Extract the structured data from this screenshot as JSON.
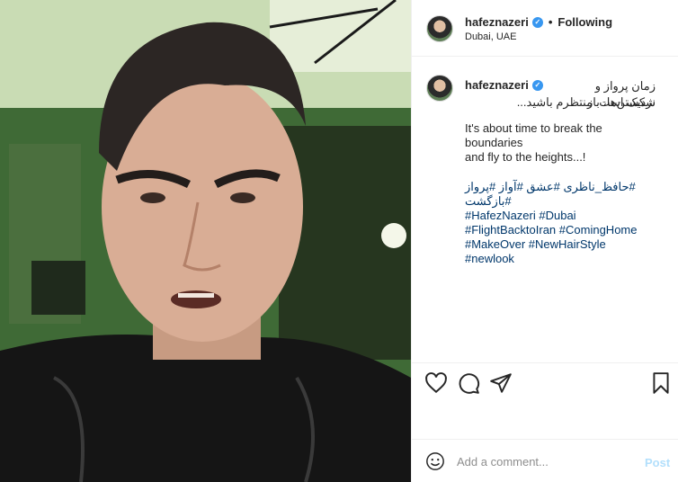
{
  "post": {
    "username": "hafeznazeri",
    "follow_label": "Following",
    "location": "Dubai, UAE",
    "caption_rtl": [
      "زمان پرواز و شکستن‌ها، باز",
      "نزدیک است. منتظرم باشید..."
    ],
    "caption_en": [
      "It's about time to break the",
      "boundaries",
      "and fly to the heights...!"
    ],
    "hashtags_rtl": "#حافظ_ناظری #عشق #آواز #پرواز #بازگشت",
    "hashtags_lines": [
      "#HafezNazeri #Dubai",
      "#FlightBacktoIran #ComingHome",
      "#MakeOver #NewHairStyle",
      "#newlook"
    ]
  },
  "comment": {
    "placeholder": "Add a comment...",
    "post_label": "Post"
  },
  "icons": [
    "verified-badge-icon",
    "heart-icon",
    "comment-icon",
    "share-icon",
    "bookmark-icon",
    "emoji-icon"
  ],
  "colors": {
    "link": "#00376b",
    "verified": "#3897f0",
    "post_disabled": "#b2dffc",
    "border": "#efefef"
  }
}
